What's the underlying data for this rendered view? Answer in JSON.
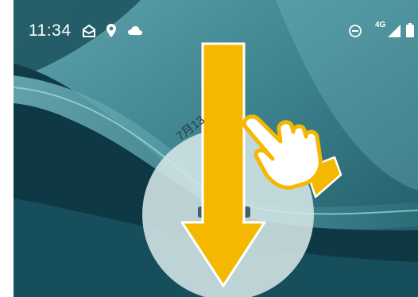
{
  "status_bar": {
    "time": "11:34",
    "network": "4G",
    "icons": [
      "mail-icon",
      "location-pin-icon",
      "cloud-icon",
      "do-not-disturb-icon",
      "signal-icon",
      "battery-icon"
    ]
  },
  "lockscreen": {
    "date_fragment": "7月13"
  },
  "gesture": {
    "direction": "swipe-down",
    "arrow_color": "#f5b800",
    "hand_color": "#ffffff",
    "hand_outline_color": "#f5b800"
  }
}
